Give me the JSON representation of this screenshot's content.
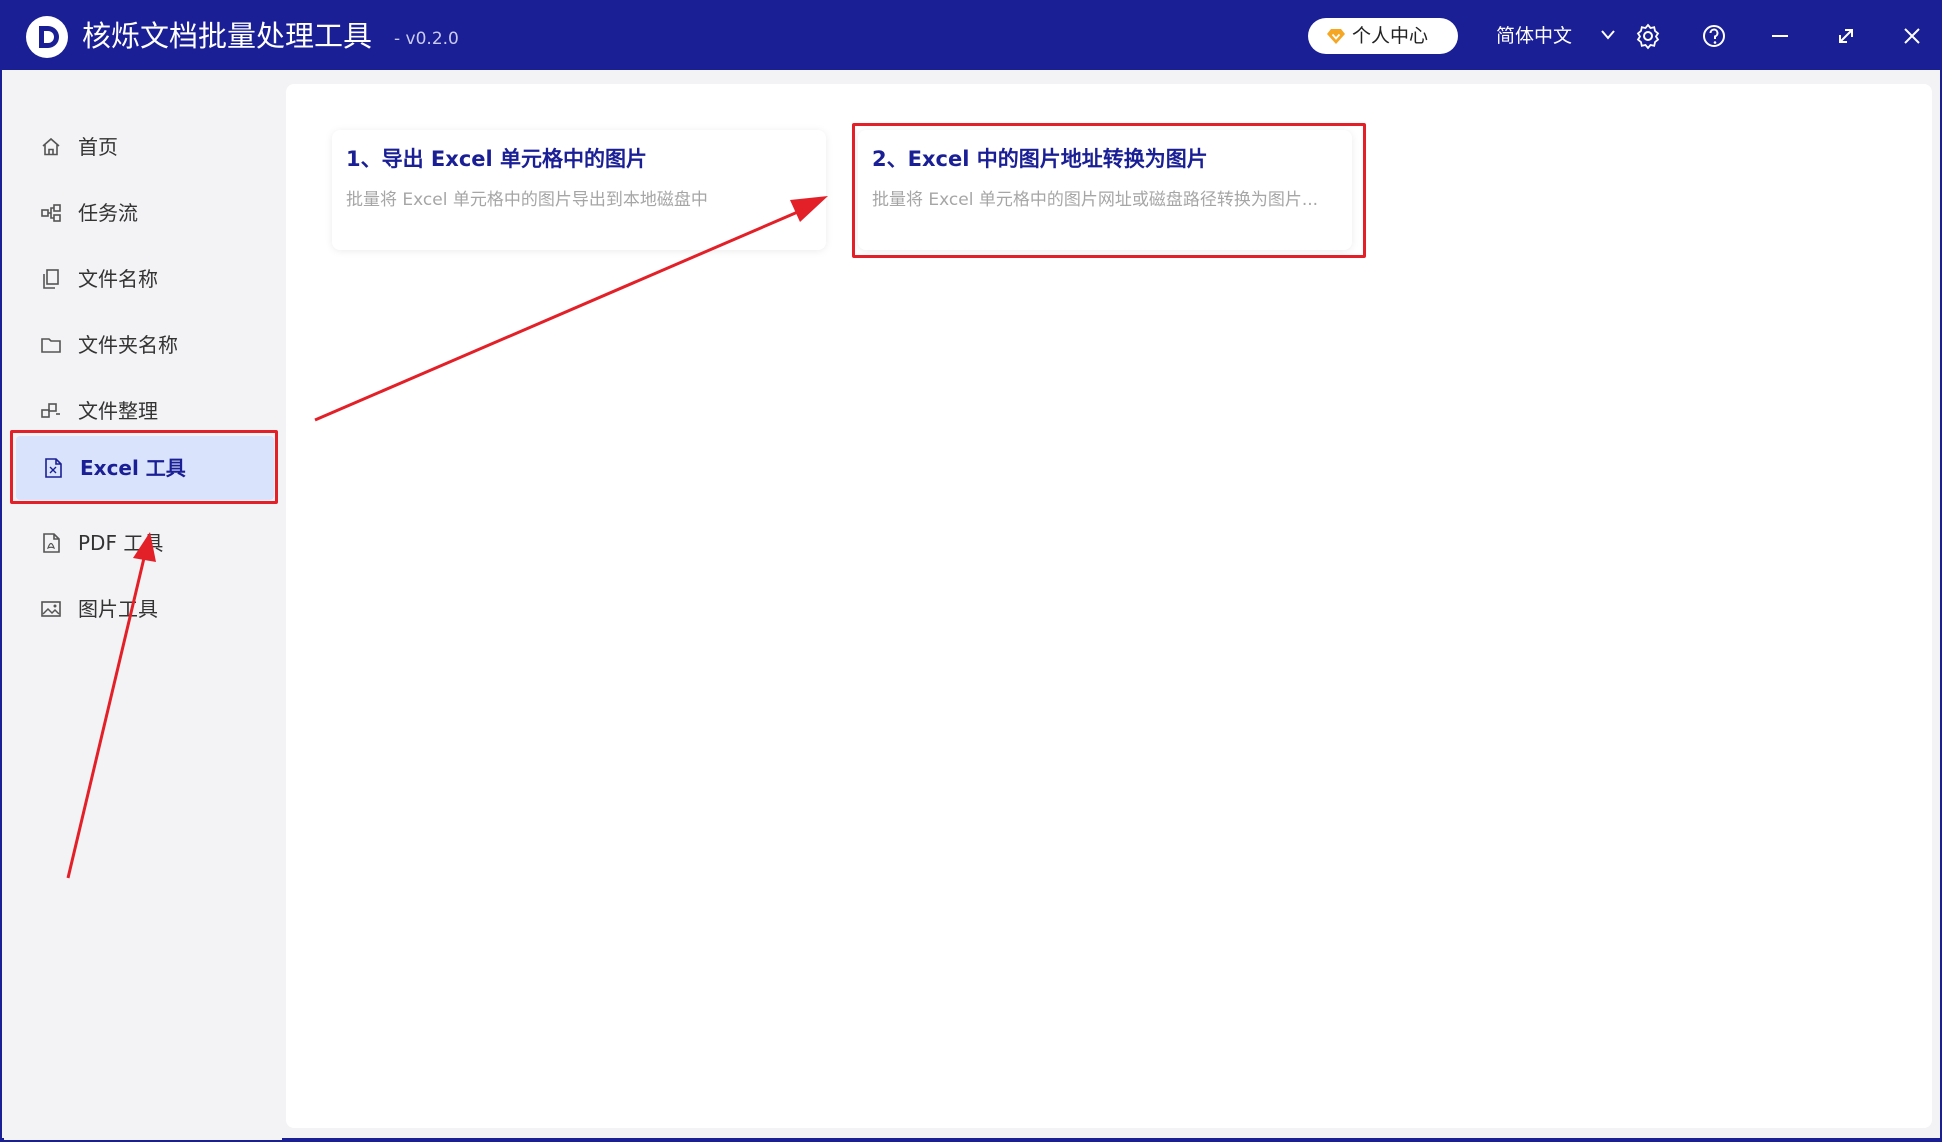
{
  "titlebar": {
    "app_name": "核烁文档批量处理工具",
    "version": "- v0.2.0",
    "user_center_label": "个人中心",
    "language_label": "简体中文",
    "icons": [
      "settings-icon",
      "help-icon",
      "minimize-icon",
      "maximize-icon",
      "close-icon"
    ]
  },
  "sidebar": {
    "items": [
      {
        "label": "首页",
        "icon": "home-icon"
      },
      {
        "label": "任务流",
        "icon": "workflow-icon"
      },
      {
        "label": "文件名称",
        "icon": "file-copy-icon"
      },
      {
        "label": "文件夹名称",
        "icon": "folder-icon"
      },
      {
        "label": "文件整理",
        "icon": "organize-icon"
      },
      {
        "label": "Excel 工具",
        "icon": "excel-file-icon",
        "active": true
      },
      {
        "label": "PDF 工具",
        "icon": "pdf-file-icon"
      },
      {
        "label": "图片工具",
        "icon": "image-icon"
      }
    ]
  },
  "main": {
    "cards": [
      {
        "title": "1、导出 Excel 单元格中的图片",
        "description": "批量将 Excel 单元格中的图片导出到本地磁盘中"
      },
      {
        "title": "2、Excel 中的图片地址转换为图片",
        "description": "批量将 Excel 单元格中的图片网址或磁盘路径转换为图片..."
      }
    ]
  },
  "colors": {
    "titlebar": "#1a1f96",
    "accent": "#1a1f96",
    "active_bg": "#d9e3fb",
    "annotation_red": "#e32028"
  }
}
